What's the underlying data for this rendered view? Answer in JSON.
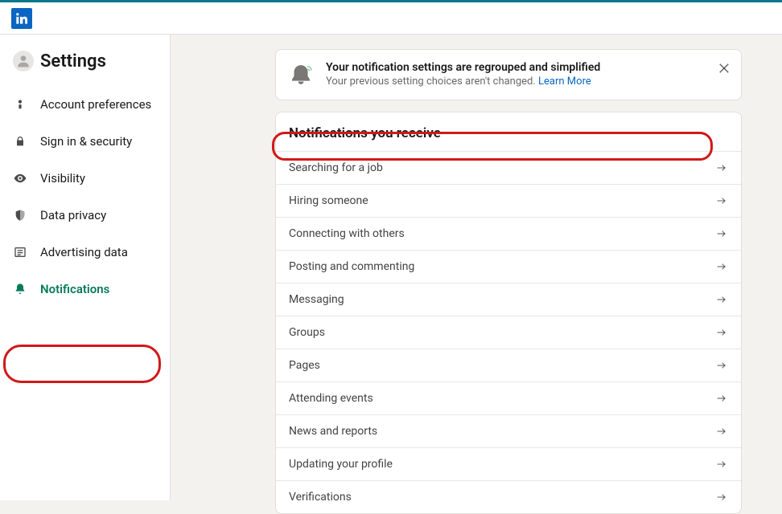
{
  "sidebar": {
    "title": "Settings",
    "items": [
      {
        "label": "Account preferences",
        "icon": "person-icon"
      },
      {
        "label": "Sign in & security",
        "icon": "lock-icon"
      },
      {
        "label": "Visibility",
        "icon": "eye-icon"
      },
      {
        "label": "Data privacy",
        "icon": "shield-icon"
      },
      {
        "label": "Advertising data",
        "icon": "newspaper-icon"
      },
      {
        "label": "Notifications",
        "icon": "bell-icon"
      }
    ],
    "activeIndex": 5
  },
  "banner": {
    "title": "Your notification settings are regrouped and simplified",
    "subtitle": "Your previous setting choices aren't changed. ",
    "link": "Learn More"
  },
  "card": {
    "title": "Notifications you receive",
    "rows": [
      "Searching for a job",
      "Hiring someone",
      "Connecting with others",
      "Posting and commenting",
      "Messaging",
      "Groups",
      "Pages",
      "Attending events",
      "News and reports",
      "Updating your profile",
      "Verifications"
    ]
  }
}
